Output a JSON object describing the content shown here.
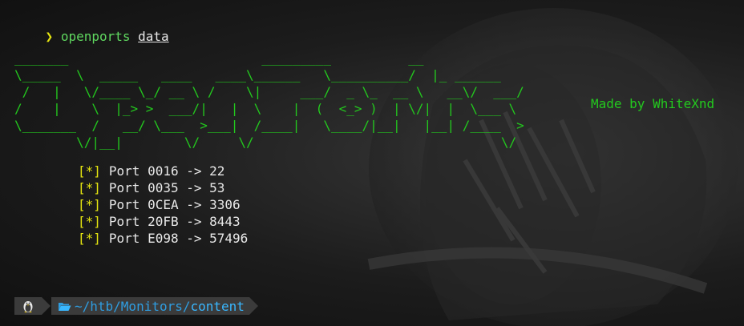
{
  "prompt": {
    "arrow": "❯",
    "command": "openports",
    "argument": "data"
  },
  "banner": {
    "ascii_lines": [
      "_______                         _________          __",
      "\\_____  \\  _____   ____   ____\\______   \\__________/  |_ ______",
      " /   |   \\/____ \\_/ __ \\ /    \\|     ___/  _ \\_  __ \\   __\\/  ___/",
      "/    |    \\  |_> >  ___/|   |  \\    |  (  <_> )  | \\/|  |  \\___ \\",
      "\\_______  /   __/ \\___  >___|  /____|   \\____/|__|   |__| /____  >",
      "        \\/|__|        \\/     \\/                                \\/"
    ],
    "credit": "Made by WhiteXnd"
  },
  "ports": [
    {
      "marker": "[*]",
      "text": "Port 0016 -> 22"
    },
    {
      "marker": "[*]",
      "text": "Port 0035 -> 53"
    },
    {
      "marker": "[*]",
      "text": "Port 0CEA -> 3306"
    },
    {
      "marker": "[*]",
      "text": "Port 20FB -> 8443"
    },
    {
      "marker": "[*]",
      "text": "Port E098 -> 57496"
    }
  ],
  "status_bar": {
    "os_icon": "linux-tux-icon",
    "folder_icon": "folder-open-icon",
    "path_prefix": "~/htb/Monitors/",
    "path_current": "content"
  },
  "colors": {
    "ascii_green": "#23c81e",
    "prompt_yellow": "#e5e510",
    "path_blue": "#39b7ff"
  }
}
